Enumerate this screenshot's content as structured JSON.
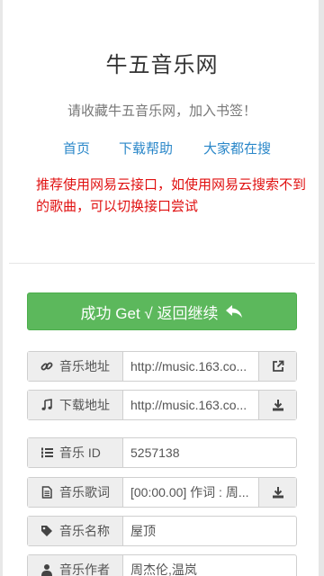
{
  "header": {
    "title": "牛五音乐网",
    "subtitle": "请收藏牛五音乐网，加入书签！"
  },
  "nav": {
    "items": [
      {
        "label": "首页"
      },
      {
        "label": "下载帮助"
      },
      {
        "label": "大家都在搜"
      }
    ]
  },
  "notice": "推荐使用网易云接口，如使用网易云搜索不到的歌曲，可以切换接口尝试",
  "success_button": {
    "label": "成功 Get √ 返回继续",
    "icon": "reply-icon",
    "color": "#5cb85c"
  },
  "fields": [
    {
      "label": "音乐地址",
      "icon": "link-icon",
      "value": "http://music.163.co...",
      "action_icon": "external-link-icon"
    },
    {
      "label": "下载地址",
      "icon": "music-note-icon",
      "value": "http://music.163.co...",
      "action_icon": "download-icon"
    },
    {
      "label": "音乐 ID",
      "icon": "list-ol-icon",
      "value": "5257138"
    },
    {
      "label": "音乐歌词",
      "icon": "file-text-icon",
      "value": "[00:00.00] 作词 : 周...",
      "action_icon": "download-icon"
    },
    {
      "label": "音乐名称",
      "icon": "tag-icon",
      "value": "屋顶"
    },
    {
      "label": "音乐作者",
      "icon": "user-icon",
      "value": "周杰伦,温岚"
    }
  ],
  "colors": {
    "link": "#2a87c9",
    "notice": "#e01010",
    "success": "#5cb85c"
  }
}
